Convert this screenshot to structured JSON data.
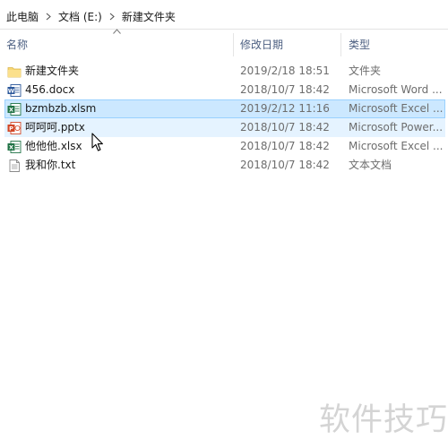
{
  "breadcrumb": {
    "items": [
      "此电脑",
      "文档 (E:)",
      "新建文件夹"
    ]
  },
  "columns": {
    "name": "名称",
    "date": "修改日期",
    "type": "类型"
  },
  "files": [
    {
      "name": "新建文件夹",
      "date": "2019/2/18 18:51",
      "type": "文件夹",
      "icon": "folder-icon",
      "state": "normal"
    },
    {
      "name": "456.docx",
      "date": "2018/10/7 18:42",
      "type": "Microsoft Word ...",
      "icon": "word-document-icon",
      "state": "normal"
    },
    {
      "name": "bzmbzb.xlsm",
      "date": "2019/2/12 11:16",
      "type": "Microsoft Excel ...",
      "icon": "excel-document-icon",
      "state": "selected"
    },
    {
      "name": "呵呵呵.pptx",
      "date": "2018/10/7 18:42",
      "type": "Microsoft Power...",
      "icon": "powerpoint-document-icon",
      "state": "hovered"
    },
    {
      "name": "他他他.xlsx",
      "date": "2018/10/7 18:42",
      "type": "Microsoft Excel ...",
      "icon": "excel-document-icon",
      "state": "normal"
    },
    {
      "name": "我和你.txt",
      "date": "2018/10/7 18:42",
      "type": "文本文档",
      "icon": "text-document-icon",
      "state": "normal"
    }
  ],
  "watermark": "软件技巧",
  "colors": {
    "selected_bg": "#cce8ff",
    "selected_border": "#99d1ff",
    "hover_bg": "#e5f3ff",
    "header_text": "#4d6082",
    "folder": "#f8d775",
    "word": "#2b579a",
    "excel": "#217346",
    "powerpoint": "#d24726"
  }
}
